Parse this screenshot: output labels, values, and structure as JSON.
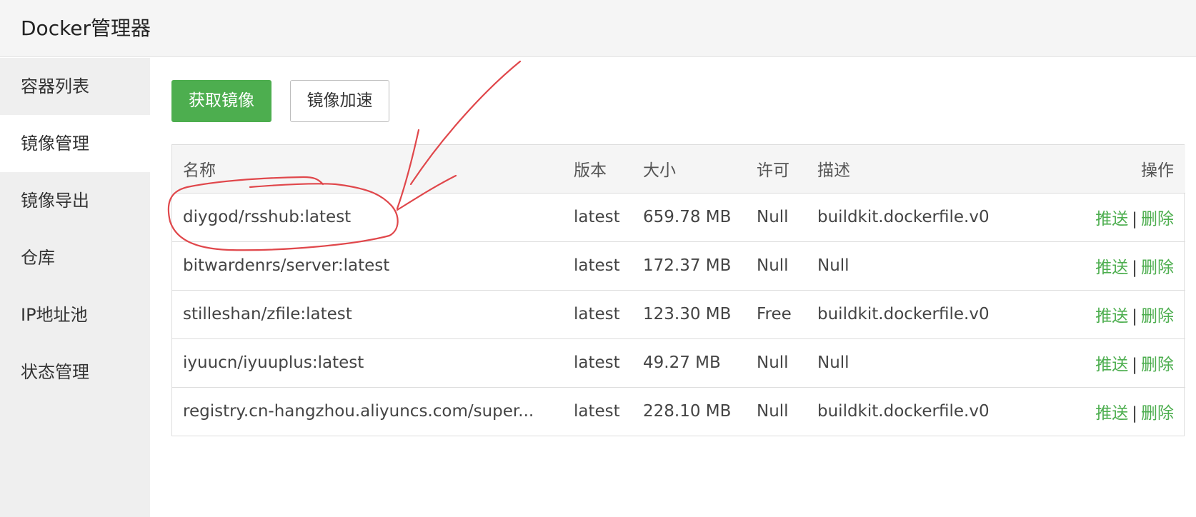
{
  "app": {
    "title": "Docker管理器"
  },
  "sidebar": {
    "items": [
      {
        "label": "容器列表",
        "active": false
      },
      {
        "label": "镜像管理",
        "active": true
      },
      {
        "label": "镜像导出",
        "active": false
      },
      {
        "label": "仓库",
        "active": false
      },
      {
        "label": "IP地址池",
        "active": false
      },
      {
        "label": "状态管理",
        "active": false
      }
    ]
  },
  "toolbar": {
    "get_image_label": "获取镜像",
    "image_accel_label": "镜像加速"
  },
  "table": {
    "headers": {
      "name": "名称",
      "version": "版本",
      "size": "大小",
      "license": "许可",
      "description": "描述",
      "ops": "操作"
    },
    "rows": [
      {
        "name": "diygod/rsshub:latest",
        "version": "latest",
        "size": "659.78 MB",
        "license": "Null",
        "description": "buildkit.dockerfile.v0"
      },
      {
        "name": "bitwardenrs/server:latest",
        "version": "latest",
        "size": "172.37 MB",
        "license": "Null",
        "description": "Null"
      },
      {
        "name": "stilleshan/zfile:latest",
        "version": "latest",
        "size": "123.30 MB",
        "license": "Free",
        "description": "buildkit.dockerfile.v0"
      },
      {
        "name": "iyuucn/iyuuplus:latest",
        "version": "latest",
        "size": "49.27 MB",
        "license": "Null",
        "description": "Null"
      },
      {
        "name": "registry.cn-hangzhou.aliyuncs.com/super...",
        "version": "latest",
        "size": "228.10 MB",
        "license": "Null",
        "description": "buildkit.dockerfile.v0"
      }
    ],
    "ops": {
      "push": "推送",
      "separator": "|",
      "delete": "删除"
    }
  },
  "colors": {
    "primary_green": "#4dae4f",
    "annotation_red": "#e0474b"
  }
}
